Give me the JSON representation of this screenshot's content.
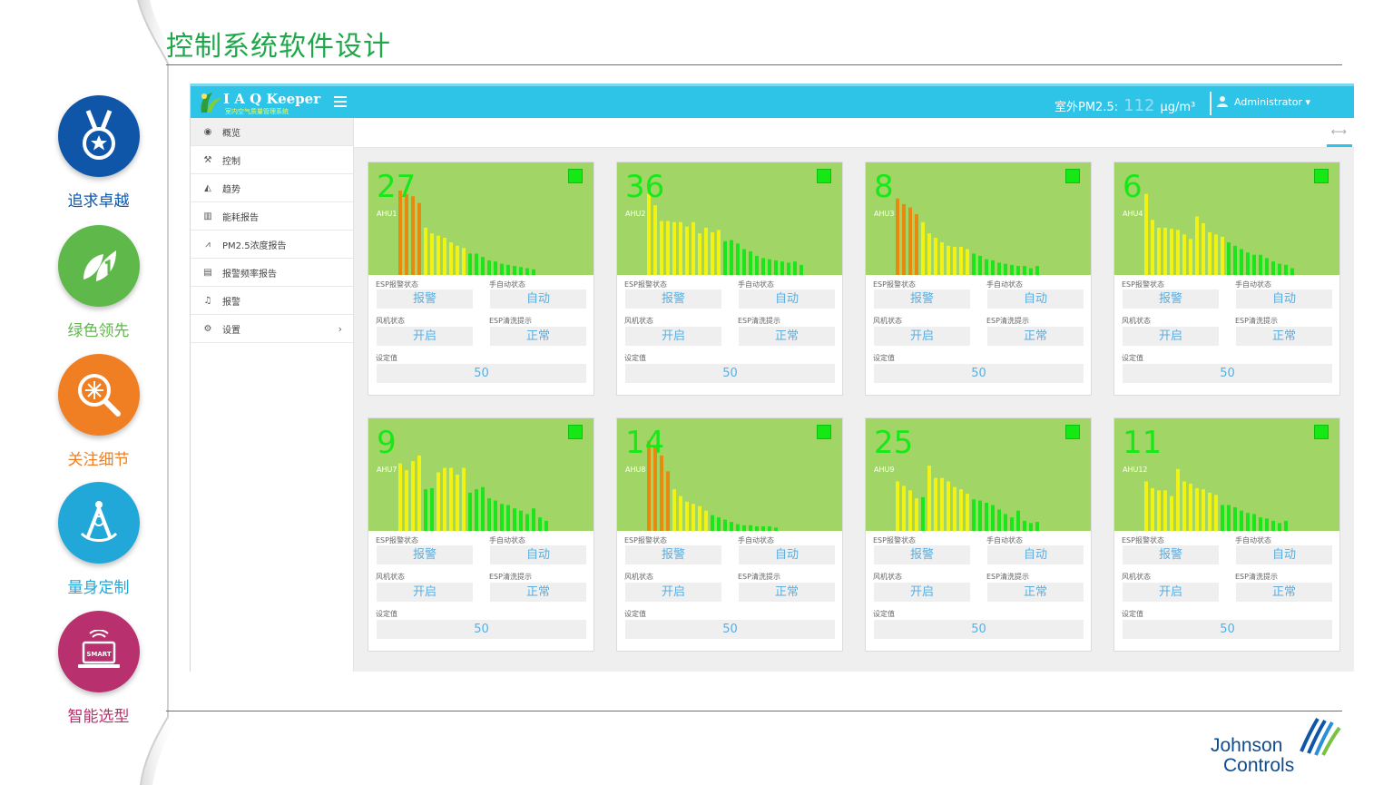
{
  "slide": {
    "title": "控制系统软件设计"
  },
  "features": [
    {
      "label": "追求卓越",
      "color": "#0f56a8",
      "label_color": "#0f56a8",
      "icon": "medal-icon"
    },
    {
      "label": "绿色领先",
      "color": "#5fb84a",
      "label_color": "#5fb84a",
      "icon": "leaf-icon"
    },
    {
      "label": "关注细节",
      "color": "#f07e22",
      "label_color": "#f07e22",
      "icon": "magnifier-snowflake-icon"
    },
    {
      "label": "量身定制",
      "color": "#22a8d8",
      "label_color": "#22a8d8",
      "icon": "compass-icon"
    },
    {
      "label": "智能选型",
      "color": "#b8306e",
      "label_color": "#b8306e",
      "icon": "smart-laptop-icon"
    }
  ],
  "app": {
    "brand": "I A Q Keeper",
    "brand_sub": "室内空气质量管理系统",
    "pm_label": "室外PM2.5:",
    "pm_value": "112",
    "pm_unit": "μg/m³",
    "user": "Administrator ▾",
    "accent": "#2ec4e8"
  },
  "sidebar": {
    "items": [
      {
        "label": "概览",
        "icon": "dashboard-icon",
        "glyph": "◉",
        "active": true
      },
      {
        "label": "控制",
        "icon": "wrench-icon",
        "glyph": "⚒"
      },
      {
        "label": "趋势",
        "icon": "area-chart-icon",
        "glyph": "◭"
      },
      {
        "label": "能耗报告",
        "icon": "bar-chart-icon",
        "glyph": "▥"
      },
      {
        "label": "PM2.5浓度报告",
        "icon": "line-chart-icon",
        "glyph": "⩘"
      },
      {
        "label": "报警频率报告",
        "icon": "file-icon",
        "glyph": "▤"
      },
      {
        "label": "报警",
        "icon": "bell-icon",
        "glyph": "♫"
      },
      {
        "label": "设置",
        "icon": "gears-icon",
        "glyph": "⚙",
        "has_submenu": true
      }
    ],
    "submenu_chevron": "›"
  },
  "labels": {
    "esp_alarm": "ESP报警状态",
    "mode": "手自动状态",
    "fan": "风机状态",
    "esp_clean": "ESP清洗提示",
    "setpoint": "设定值"
  },
  "units": [
    {
      "count": "27",
      "name": "AHU1",
      "esp_alarm": "报警",
      "mode": "自动",
      "fan": "开启",
      "esp_clean": "正常",
      "setpoint": "50",
      "bars": [
        [
          0.75,
          "o"
        ],
        [
          0.72,
          "o"
        ],
        [
          0.7,
          "o"
        ],
        [
          0.64,
          "o"
        ],
        [
          0.42,
          "y"
        ],
        [
          0.37,
          "y"
        ],
        [
          0.35,
          "y"
        ],
        [
          0.33,
          "y"
        ],
        [
          0.29,
          "y"
        ],
        [
          0.26,
          "y"
        ],
        [
          0.24,
          "y"
        ],
        [
          0.19,
          "g"
        ],
        [
          0.19,
          "g"
        ],
        [
          0.16,
          "g"
        ],
        [
          0.13,
          "g"
        ],
        [
          0.12,
          "g"
        ],
        [
          0.1,
          "g"
        ],
        [
          0.09,
          "g"
        ],
        [
          0.08,
          "g"
        ],
        [
          0.07,
          "g"
        ],
        [
          0.06,
          "g"
        ],
        [
          0.05,
          "g"
        ]
      ]
    },
    {
      "count": "36",
      "name": "AHU2",
      "esp_alarm": "报警",
      "mode": "自动",
      "fan": "开启",
      "esp_clean": "正常",
      "setpoint": "50",
      "bars": [
        [
          0.72,
          "y"
        ],
        [
          0.62,
          "y"
        ],
        [
          0.48,
          "y"
        ],
        [
          0.48,
          "y"
        ],
        [
          0.47,
          "y"
        ],
        [
          0.47,
          "y"
        ],
        [
          0.43,
          "y"
        ],
        [
          0.47,
          "y"
        ],
        [
          0.37,
          "y"
        ],
        [
          0.42,
          "y"
        ],
        [
          0.38,
          "y"
        ],
        [
          0.4,
          "y"
        ],
        [
          0.3,
          "g"
        ],
        [
          0.31,
          "g"
        ],
        [
          0.28,
          "g"
        ],
        [
          0.23,
          "g"
        ],
        [
          0.21,
          "g"
        ],
        [
          0.17,
          "g"
        ],
        [
          0.15,
          "g"
        ],
        [
          0.14,
          "g"
        ],
        [
          0.13,
          "g"
        ],
        [
          0.12,
          "g"
        ],
        [
          0.11,
          "g"
        ],
        [
          0.12,
          "g"
        ],
        [
          0.09,
          "g"
        ]
      ]
    },
    {
      "count": "8",
      "name": "AHU3",
      "esp_alarm": "报警",
      "mode": "自动",
      "fan": "开启",
      "esp_clean": "正常",
      "setpoint": "50",
      "bars": [
        [
          0.68,
          "o"
        ],
        [
          0.63,
          "o"
        ],
        [
          0.6,
          "o"
        ],
        [
          0.54,
          "o"
        ],
        [
          0.47,
          "y"
        ],
        [
          0.37,
          "y"
        ],
        [
          0.33,
          "y"
        ],
        [
          0.29,
          "y"
        ],
        [
          0.26,
          "y"
        ],
        [
          0.25,
          "y"
        ],
        [
          0.25,
          "y"
        ],
        [
          0.23,
          "y"
        ],
        [
          0.19,
          "g"
        ],
        [
          0.17,
          "g"
        ],
        [
          0.14,
          "g"
        ],
        [
          0.13,
          "g"
        ],
        [
          0.11,
          "g"
        ],
        [
          0.1,
          "g"
        ],
        [
          0.09,
          "g"
        ],
        [
          0.08,
          "g"
        ],
        [
          0.08,
          "g"
        ],
        [
          0.06,
          "g"
        ],
        [
          0.08,
          "g"
        ]
      ]
    },
    {
      "count": "6",
      "name": "AHU4",
      "esp_alarm": "报警",
      "mode": "自动",
      "fan": "开启",
      "esp_clean": "正常",
      "setpoint": "50",
      "bars": [
        [
          0.72,
          "y"
        ],
        [
          0.49,
          "y"
        ],
        [
          0.42,
          "y"
        ],
        [
          0.42,
          "y"
        ],
        [
          0.41,
          "y"
        ],
        [
          0.4,
          "y"
        ],
        [
          0.36,
          "y"
        ],
        [
          0.32,
          "y"
        ],
        [
          0.52,
          "y"
        ],
        [
          0.46,
          "y"
        ],
        [
          0.38,
          "y"
        ],
        [
          0.36,
          "y"
        ],
        [
          0.34,
          "y"
        ],
        [
          0.29,
          "g"
        ],
        [
          0.26,
          "g"
        ],
        [
          0.23,
          "g"
        ],
        [
          0.2,
          "g"
        ],
        [
          0.18,
          "g"
        ],
        [
          0.18,
          "g"
        ],
        [
          0.15,
          "g"
        ],
        [
          0.12,
          "g"
        ],
        [
          0.1,
          "g"
        ],
        [
          0.09,
          "g"
        ],
        [
          0.06,
          "g"
        ]
      ]
    },
    {
      "count": "9",
      "name": "AHU7",
      "esp_alarm": "报警",
      "mode": "自动",
      "fan": "开启",
      "esp_clean": "正常",
      "setpoint": "50",
      "bars": [
        [
          0.6,
          "y"
        ],
        [
          0.54,
          "y"
        ],
        [
          0.62,
          "y"
        ],
        [
          0.67,
          "y"
        ],
        [
          0.37,
          "g"
        ],
        [
          0.38,
          "g"
        ],
        [
          0.52,
          "y"
        ],
        [
          0.56,
          "y"
        ],
        [
          0.56,
          "y"
        ],
        [
          0.5,
          "y"
        ],
        [
          0.56,
          "y"
        ],
        [
          0.34,
          "g"
        ],
        [
          0.37,
          "g"
        ],
        [
          0.39,
          "g"
        ],
        [
          0.29,
          "g"
        ],
        [
          0.27,
          "g"
        ],
        [
          0.24,
          "g"
        ],
        [
          0.23,
          "g"
        ],
        [
          0.2,
          "g"
        ],
        [
          0.18,
          "g"
        ],
        [
          0.15,
          "g"
        ],
        [
          0.2,
          "g"
        ],
        [
          0.12,
          "g"
        ],
        [
          0.09,
          "g"
        ]
      ]
    },
    {
      "count": "14",
      "name": "AHU8",
      "esp_alarm": "报警",
      "mode": "自动",
      "fan": "开启",
      "esp_clean": "正常",
      "setpoint": "50",
      "bars": [
        [
          0.8,
          "o"
        ],
        [
          0.75,
          "o"
        ],
        [
          0.67,
          "o"
        ],
        [
          0.53,
          "o"
        ],
        [
          0.37,
          "y"
        ],
        [
          0.31,
          "y"
        ],
        [
          0.26,
          "y"
        ],
        [
          0.24,
          "y"
        ],
        [
          0.22,
          "y"
        ],
        [
          0.18,
          "y"
        ],
        [
          0.14,
          "g"
        ],
        [
          0.12,
          "g"
        ],
        [
          0.1,
          "g"
        ],
        [
          0.08,
          "g"
        ],
        [
          0.06,
          "g"
        ],
        [
          0.05,
          "g"
        ],
        [
          0.05,
          "g"
        ],
        [
          0.04,
          "g"
        ],
        [
          0.04,
          "g"
        ],
        [
          0.04,
          "g"
        ],
        [
          0.03,
          "g"
        ]
      ]
    },
    {
      "count": "25",
      "name": "AHU9",
      "esp_alarm": "报警",
      "mode": "自动",
      "fan": "开启",
      "esp_clean": "正常",
      "setpoint": "50",
      "bars": [
        [
          0.44,
          "y"
        ],
        [
          0.4,
          "y"
        ],
        [
          0.36,
          "y"
        ],
        [
          0.29,
          "y"
        ],
        [
          0.3,
          "g"
        ],
        [
          0.58,
          "y"
        ],
        [
          0.47,
          "y"
        ],
        [
          0.47,
          "y"
        ],
        [
          0.44,
          "y"
        ],
        [
          0.39,
          "y"
        ],
        [
          0.37,
          "y"
        ],
        [
          0.33,
          "y"
        ],
        [
          0.28,
          "g"
        ],
        [
          0.27,
          "g"
        ],
        [
          0.25,
          "g"
        ],
        [
          0.23,
          "g"
        ],
        [
          0.19,
          "g"
        ],
        [
          0.15,
          "g"
        ],
        [
          0.12,
          "g"
        ],
        [
          0.18,
          "g"
        ],
        [
          0.09,
          "g"
        ],
        [
          0.07,
          "g"
        ],
        [
          0.08,
          "g"
        ]
      ]
    },
    {
      "count": "11",
      "name": "AHU12",
      "esp_alarm": "报警",
      "mode": "自动",
      "fan": "开启",
      "esp_clean": "正常",
      "setpoint": "50",
      "bars": [
        [
          0.44,
          "y"
        ],
        [
          0.38,
          "y"
        ],
        [
          0.36,
          "y"
        ],
        [
          0.36,
          "y"
        ],
        [
          0.31,
          "y"
        ],
        [
          0.55,
          "y"
        ],
        [
          0.44,
          "y"
        ],
        [
          0.42,
          "y"
        ],
        [
          0.38,
          "y"
        ],
        [
          0.37,
          "y"
        ],
        [
          0.34,
          "y"
        ],
        [
          0.32,
          "y"
        ],
        [
          0.23,
          "g"
        ],
        [
          0.23,
          "g"
        ],
        [
          0.21,
          "g"
        ],
        [
          0.18,
          "g"
        ],
        [
          0.16,
          "g"
        ],
        [
          0.15,
          "g"
        ],
        [
          0.12,
          "g"
        ],
        [
          0.11,
          "g"
        ],
        [
          0.09,
          "g"
        ],
        [
          0.07,
          "g"
        ],
        [
          0.09,
          "g"
        ]
      ]
    }
  ],
  "colors": {
    "bar_orange": "#e88a10",
    "bar_yellow": "#f2f215",
    "bar_green": "#1de51d",
    "chart_bg": "#a1d667",
    "count_green": "#18e818",
    "value_blue": "#5aaee0"
  },
  "footer": {
    "logo_line1": "Johnson",
    "logo_line2": "Controls"
  }
}
